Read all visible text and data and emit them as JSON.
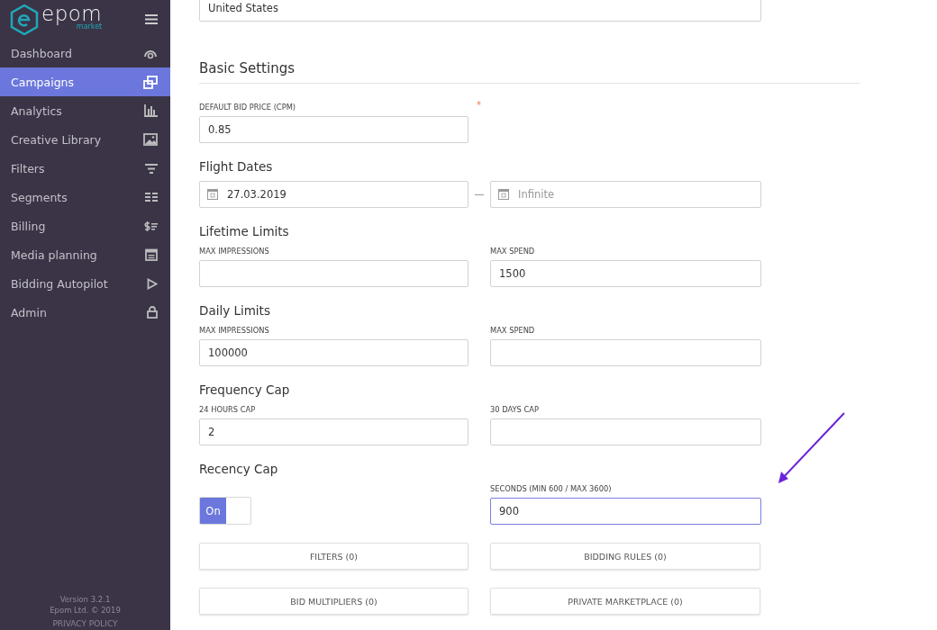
{
  "sidebar": {
    "logo": {
      "name": "epom",
      "sub": "market"
    },
    "items": [
      {
        "label": "Dashboard",
        "selected": false
      },
      {
        "label": "Campaigns",
        "selected": true
      },
      {
        "label": "Analytics",
        "selected": false
      },
      {
        "label": "Creative Library",
        "selected": false
      },
      {
        "label": "Filters",
        "selected": false
      },
      {
        "label": "Segments",
        "selected": false
      },
      {
        "label": "Billing",
        "selected": false
      },
      {
        "label": "Media planning",
        "selected": false
      },
      {
        "label": "Bidding Autopilot",
        "selected": false
      },
      {
        "label": "Admin",
        "selected": false
      }
    ],
    "version": "Version 3.2.1",
    "copyright": "Epom Ltd. © 2019",
    "privacy": "PRIVACY POLICY"
  },
  "top_field": {
    "value": "United States"
  },
  "page_title": "Basic Settings",
  "sections": [
    {
      "rows": [
        {
          "kind": "text",
          "label": "DEFAULT BID PRICE (CPM)",
          "value": "0.85",
          "required_mark": "*"
        }
      ]
    },
    {
      "title": "Flight Dates",
      "rows": [
        {
          "kind": "date",
          "value": "27.03.2019"
        },
        {
          "kind": "date",
          "placeholder": "Infinite"
        }
      ]
    },
    {
      "title": "Lifetime Limits",
      "rows": [
        {
          "kind": "text",
          "label": "MAX IMPRESSIONS"
        },
        {
          "kind": "text",
          "label": "MAX SPEND",
          "value": "1500"
        }
      ]
    },
    {
      "title": "Daily Limits",
      "rows": [
        {
          "kind": "text",
          "label": "MAX IMPRESSIONS",
          "value": "100000"
        },
        {
          "kind": "text",
          "label": "MAX SPEND"
        }
      ]
    },
    {
      "title": "Frequency Cap",
      "rows": [
        {
          "kind": "text",
          "label": "24 HOURS CAP",
          "value": "2"
        },
        {
          "kind": "text",
          "label": "30 DAYS CAP"
        }
      ]
    },
    {
      "title": "Recency Cap",
      "rows": [
        {
          "kind": "toggle",
          "label_on": "On",
          "on": true
        },
        {
          "kind": "text",
          "label": "SECONDS (MIN 600 / MAX 3600)",
          "value": "900",
          "focused": true
        }
      ]
    }
  ],
  "buttons": [
    "FILTERS (0)",
    "BIDDING RULES (0)",
    "BID MULTIPLIERS (0)",
    "PRIVATE MARKETPLACE (0)"
  ]
}
